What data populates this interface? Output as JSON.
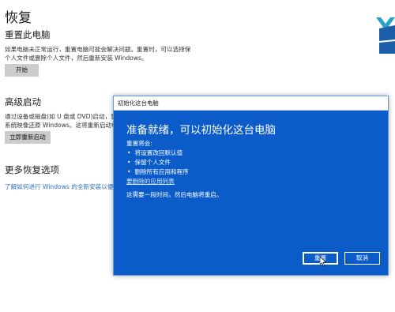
{
  "settings": {
    "page_title": "恢复",
    "reset": {
      "heading": "重置此电脑",
      "desc_line1": "如果电脑未正常运行，重置电脑可能会解决问题。重置时，可以选择保留",
      "desc_line2": "个人文件或删除个人文件，然后重新安装 Windows。",
      "button": "开始"
    },
    "advanced": {
      "heading": "高级启动",
      "desc_line1": "通过设备或磁盘(如 U 盘或 DVD)启动，更改 W",
      "desc_line2": "系统映像还原 Windows。这将重新启动电脑。",
      "button": "立即重新启动"
    },
    "more": {
      "heading": "更多恢复选项",
      "link": "了解如何进行 Windows 的全新安装以便开始使用"
    }
  },
  "dialog": {
    "window_title": "初始化这台电脑",
    "heading": "准备就绪，可以初始化这台电脑",
    "reset_will": "重置将会:",
    "bullets": [
      "将设置改回默认值",
      "保留个人文件",
      "删除所有应用和程序"
    ],
    "link": "要删除的应用列表",
    "note": "这需要一段时间，然后电脑将重启。",
    "reset_button": "重置",
    "cancel_button": "取消"
  },
  "colors": {
    "dialog_bg": "#0b5cc9",
    "link": "#2c6fc8"
  }
}
